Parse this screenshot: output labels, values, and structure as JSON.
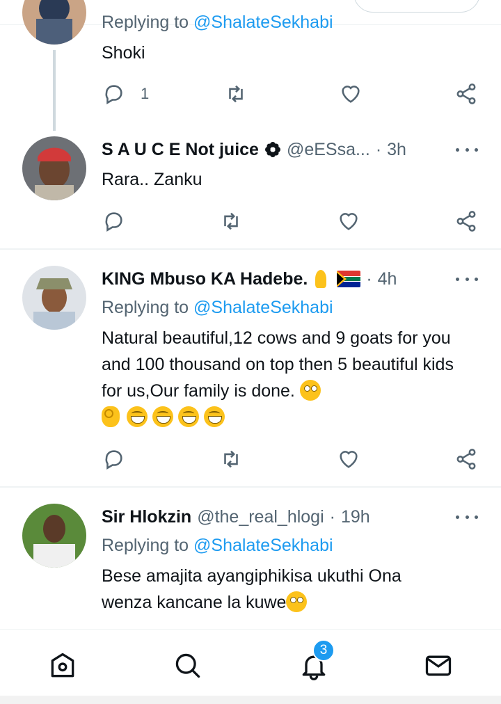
{
  "tweets": [
    {
      "reply_prefix": "Replying to",
      "reply_to": "@ShalateSekhabi",
      "text": "Shoki",
      "reply_count": "1"
    },
    {
      "name": "S A U C E Not juice",
      "handle": "@eESsa...",
      "time": "3h",
      "text": "Rara.. Zanku"
    },
    {
      "name": "KING Mbuso KA Hadebe.",
      "time": "4h",
      "reply_prefix": "Replying to",
      "reply_to": "@ShalateSekhabi",
      "text": "Natural beautiful,12 cows and 9 goats for you and 100 thousand on top then 5 beautiful kids for us,Our family is done."
    },
    {
      "name": "Sir Hlokzin",
      "handle": "@the_real_hlogi",
      "time": "19h",
      "reply_prefix": "Replying to",
      "reply_to": "@ShalateSekhabi",
      "text": "Bese amajita ayangiphikisa ukuthi Ona wenza kancane la kuwe"
    }
  ],
  "separator": "·",
  "bottom_nav": {
    "items": [
      "home-icon",
      "search-icon",
      "notifications-icon",
      "messages-icon"
    ],
    "notification_count": "3"
  },
  "colors": {
    "accent": "#1d9bf0",
    "secondary_text": "#536471",
    "primary_text": "#0f1419"
  }
}
